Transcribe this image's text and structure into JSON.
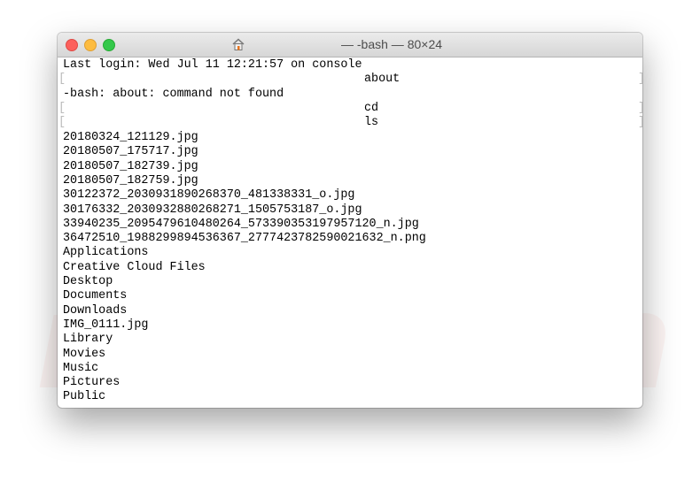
{
  "window": {
    "title": "— -bash — 80×24",
    "icon": "home-icon"
  },
  "terminal": {
    "login": "Last login: Wed Jul 11 12:21:57 on console",
    "prompt_about": "about",
    "error": "-bash: about: command not found",
    "prompt_cd": "cd",
    "prompt_ls": "ls",
    "listing": [
      "20180324_121129.jpg",
      "20180507_175717.jpg",
      "20180507_182739.jpg",
      "20180507_182759.jpg",
      "30122372_2030931890268370_481338331_o.jpg",
      "30176332_2030932880268271_1505753187_o.jpg",
      "33940235_2095479610480264_573390353197957120_n.jpg",
      "36472510_1988299894536367_2777423782590021632_n.png",
      "Applications",
      "Creative Cloud Files",
      "Desktop",
      "Documents",
      "Downloads",
      "IMG_0111.jpg",
      "Library",
      "Movies",
      "Music",
      "Pictures",
      "Public"
    ]
  },
  "watermark": "PC risk.com"
}
